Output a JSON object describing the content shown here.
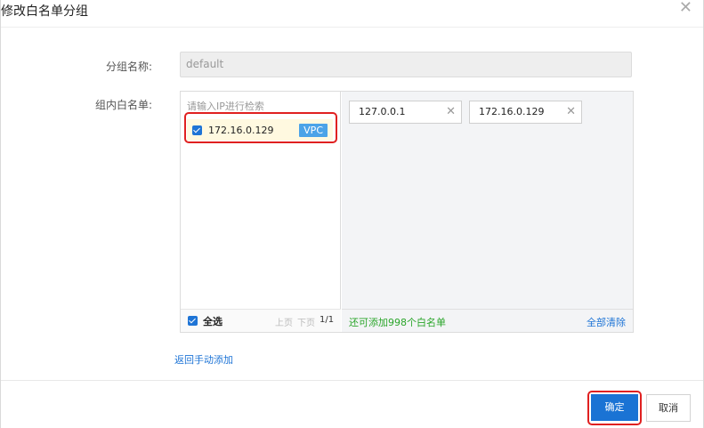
{
  "dialog": {
    "title": "修改白名单分组",
    "close_icon": "close-icon"
  },
  "form": {
    "group_name_label": "分组名称:",
    "group_name_value": "default",
    "whitelist_label": "组内白名单:"
  },
  "left_pane": {
    "search_placeholder": "请输入IP进行检索",
    "items": [
      {
        "ip": "172.16.0.129",
        "tag": "VPC",
        "checked": true
      }
    ],
    "select_all_label": "全选",
    "prev_label": "上页",
    "next_label": "下页",
    "page": "1/1"
  },
  "right_pane": {
    "tags": [
      {
        "ip": "127.0.0.1"
      },
      {
        "ip": "172.16.0.129"
      }
    ],
    "remaining_text": "还可添加998个白名单",
    "clear_all_label": "全部清除"
  },
  "back_link": "返回手动添加",
  "buttons": {
    "ok": "确定",
    "cancel": "取消"
  },
  "colors": {
    "primary": "#1a73d4",
    "highlight": "#e02020",
    "success": "#2aa52a",
    "vpc_tag": "#4ba3e8"
  }
}
